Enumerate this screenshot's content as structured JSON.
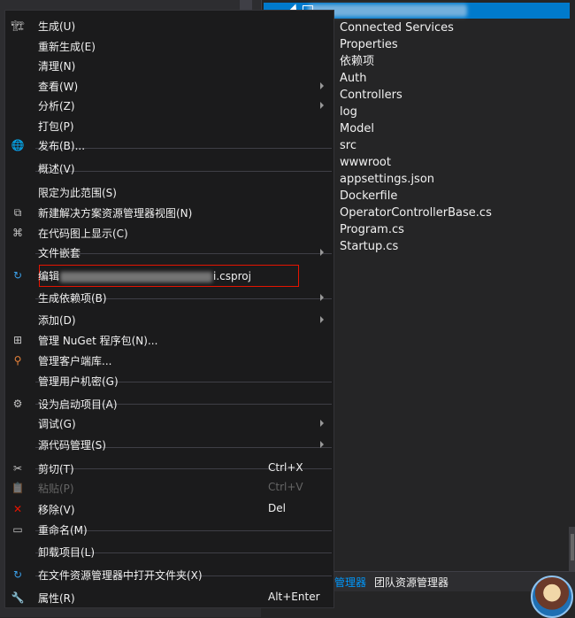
{
  "menu": {
    "items": [
      {
        "label": "生成(U)",
        "icon": "build-icon",
        "shortcut": "",
        "submenu": false,
        "disabled": false
      },
      {
        "label": "重新生成(E)",
        "icon": "",
        "shortcut": "",
        "submenu": false,
        "disabled": false
      },
      {
        "label": "清理(N)",
        "icon": "",
        "shortcut": "",
        "submenu": false,
        "disabled": false
      },
      {
        "label": "查看(W)",
        "icon": "",
        "shortcut": "",
        "submenu": true,
        "disabled": false
      },
      {
        "label": "分析(Z)",
        "icon": "",
        "shortcut": "",
        "submenu": true,
        "disabled": false
      },
      {
        "label": "打包(P)",
        "icon": "",
        "shortcut": "",
        "submenu": false,
        "disabled": false
      },
      {
        "label": "发布(B)...",
        "icon": "globe-icon",
        "shortcut": "",
        "submenu": false,
        "disabled": false
      },
      {
        "label": "概述(V)",
        "icon": "",
        "shortcut": "",
        "submenu": false,
        "disabled": false
      },
      {
        "label": "限定为此范围(S)",
        "icon": "",
        "shortcut": "",
        "submenu": false,
        "disabled": false
      },
      {
        "label": "新建解决方案资源管理器视图(N)",
        "icon": "new-view-icon",
        "shortcut": "",
        "submenu": false,
        "disabled": false
      },
      {
        "label": "在代码图上显示(C)",
        "icon": "code-map-icon",
        "shortcut": "",
        "submenu": false,
        "disabled": false
      },
      {
        "label": "文件嵌套",
        "icon": "",
        "shortcut": "",
        "submenu": true,
        "disabled": false
      },
      {
        "label_prefix": "编辑",
        "label_suffix": "i.csproj",
        "icon": "edit-project-icon",
        "shortcut": "",
        "submenu": false,
        "disabled": false
      },
      {
        "label": "生成依赖项(B)",
        "icon": "",
        "shortcut": "",
        "submenu": true,
        "disabled": false
      },
      {
        "label": "添加(D)",
        "icon": "",
        "shortcut": "",
        "submenu": true,
        "disabled": false
      },
      {
        "label": "管理 NuGet 程序包(N)...",
        "icon": "nuget-icon",
        "shortcut": "",
        "submenu": false,
        "disabled": false
      },
      {
        "label": "管理客户端库...",
        "icon": "client-library-icon",
        "shortcut": "",
        "submenu": false,
        "disabled": false
      },
      {
        "label": "管理用户机密(G)",
        "icon": "",
        "shortcut": "",
        "submenu": false,
        "disabled": false
      },
      {
        "label": "设为启动项目(A)",
        "icon": "gear-icon",
        "shortcut": "",
        "submenu": false,
        "disabled": false
      },
      {
        "label": "调试(G)",
        "icon": "",
        "shortcut": "",
        "submenu": true,
        "disabled": false
      },
      {
        "label": "源代码管理(S)",
        "icon": "",
        "shortcut": "",
        "submenu": true,
        "disabled": false
      },
      {
        "label": "剪切(T)",
        "icon": "scissors-icon",
        "shortcut": "Ctrl+X",
        "submenu": false,
        "disabled": false
      },
      {
        "label": "粘贴(P)",
        "icon": "paste-icon",
        "shortcut": "Ctrl+V",
        "submenu": false,
        "disabled": true
      },
      {
        "label": "移除(V)",
        "icon": "remove-icon",
        "shortcut": "Del",
        "submenu": false,
        "disabled": false
      },
      {
        "label": "重命名(M)",
        "icon": "rename-icon",
        "shortcut": "",
        "submenu": false,
        "disabled": false
      },
      {
        "label": "卸载项目(L)",
        "icon": "",
        "shortcut": "",
        "submenu": false,
        "disabled": false
      },
      {
        "label": "在文件资源管理器中打开文件夹(X)",
        "icon": "open-folder-icon",
        "shortcut": "",
        "submenu": false,
        "disabled": false
      },
      {
        "label": "属性(R)",
        "icon": "wrench-icon",
        "shortcut": "Alt+Enter",
        "submenu": false,
        "disabled": false
      }
    ]
  },
  "explorer": {
    "tree_items": [
      "Connected Services",
      "Properties",
      "依赖项",
      "Auth",
      "Controllers",
      "log",
      "Model",
      "src",
      "wwwroot",
      "appsettings.json",
      "Dockerfile",
      "OperatorControllerBase.cs",
      "Program.cs",
      "Startup.cs"
    ]
  },
  "tabs": {
    "active": "管理器",
    "inactive": "团队资源管理器"
  },
  "colors": {
    "accent": "#007acc",
    "menu_bg": "#1b1b1c",
    "highlight_border": "#e51400"
  }
}
